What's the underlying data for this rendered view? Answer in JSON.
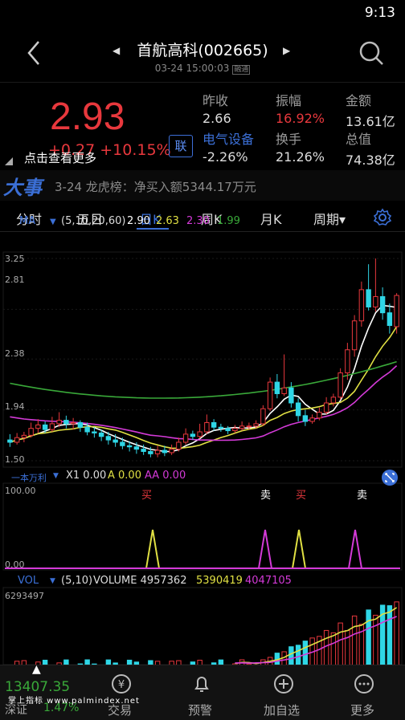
{
  "status": {
    "time": "9:13"
  },
  "header": {
    "title": "首航高科(002665)",
    "subtitle": "03-24 15:00:03",
    "subtitle_badge": "融通"
  },
  "quote": {
    "price": "2.93",
    "change": "+0.27  +10.15%",
    "lian_label": "联",
    "more_label": "点击查看更多",
    "sector": "电气设备",
    "sector_change": "-2.26%",
    "fields": [
      {
        "label": "昨收",
        "value": "2.66"
      },
      {
        "label": "振幅",
        "value": "16.92%"
      },
      {
        "label": "金额",
        "value": "13.61亿"
      },
      {
        "label": "换手",
        "value": "21.26%"
      },
      {
        "label": "总值",
        "value": "74.38亿"
      }
    ],
    "colors": {
      "up": "#e8383d",
      "accent": "#3b6fd6"
    }
  },
  "news": {
    "logo": "大事",
    "text": "3-24 龙虎榜：净买入额5344.17万元"
  },
  "tabs": [
    "分时",
    "五日",
    "日K",
    "周K",
    "月K",
    "周期▾"
  ],
  "active_tab": "日K",
  "ma_bar": {
    "label": "MA",
    "params": "(5,10,20,60)",
    "values": [
      "2.90",
      "2.63",
      "2.30",
      "1.99"
    ],
    "colors": [
      "#ffffff",
      "#e0e043",
      "#d43ad8",
      "#39a839"
    ]
  },
  "indicator": {
    "name": "一本万利",
    "values_text": "X1 0.00",
    "a_text": "A 0.00",
    "aa_text": "AA 0.00",
    "top": "100.00",
    "bottom": "0.00",
    "signals": [
      "买",
      "卖",
      "买",
      "卖"
    ]
  },
  "volume": {
    "label": "VOL",
    "params": "(5,10)",
    "text": "VOLUME 4957362",
    "ma5": "5390419",
    "ma10": "4047105",
    "top": "6293497"
  },
  "price_axis": [
    "3.25",
    "2.81",
    "2.38",
    "1.94",
    "1.50"
  ],
  "index_ticker": {
    "name": "深证",
    "value": "13407.35",
    "change": "1.47%"
  },
  "watermark": "掌上指标 www.palmindex.net",
  "footer": {
    "items": [
      {
        "label": "交易",
        "icon": "yen-icon"
      },
      {
        "label": "预警",
        "icon": "bell-icon"
      },
      {
        "label": "加自选",
        "icon": "plus-circle-icon"
      },
      {
        "label": "更多",
        "icon": "more-icon"
      }
    ]
  },
  "chart_data": {
    "type": "candlestick",
    "ylim": [
      1.5,
      3.25
    ],
    "candles": [
      [
        1.68,
        1.66,
        1.73,
        1.62
      ],
      [
        1.66,
        1.7,
        1.74,
        1.64
      ],
      [
        1.7,
        1.72,
        1.75,
        1.66
      ],
      [
        1.72,
        1.78,
        1.83,
        1.7
      ],
      [
        1.78,
        1.81,
        1.86,
        1.74
      ],
      [
        1.81,
        1.77,
        1.84,
        1.74
      ],
      [
        1.77,
        1.82,
        1.88,
        1.75
      ],
      [
        1.82,
        1.85,
        1.92,
        1.79
      ],
      [
        1.85,
        1.82,
        1.89,
        1.78
      ],
      [
        1.82,
        1.83,
        1.87,
        1.77
      ],
      [
        1.83,
        1.79,
        1.85,
        1.75
      ],
      [
        1.79,
        1.75,
        1.83,
        1.72
      ],
      [
        1.75,
        1.74,
        1.79,
        1.7
      ],
      [
        1.74,
        1.71,
        1.77,
        1.67
      ],
      [
        1.71,
        1.68,
        1.75,
        1.64
      ],
      [
        1.68,
        1.66,
        1.73,
        1.62
      ],
      [
        1.66,
        1.63,
        1.7,
        1.6
      ],
      [
        1.63,
        1.62,
        1.67,
        1.58
      ],
      [
        1.62,
        1.6,
        1.66,
        1.56
      ],
      [
        1.6,
        1.58,
        1.64,
        1.55
      ],
      [
        1.58,
        1.56,
        1.62,
        1.53
      ],
      [
        1.56,
        1.59,
        1.63,
        1.53
      ],
      [
        1.59,
        1.57,
        1.63,
        1.54
      ],
      [
        1.57,
        1.6,
        1.64,
        1.55
      ],
      [
        1.6,
        1.66,
        1.7,
        1.58
      ],
      [
        1.66,
        1.73,
        1.78,
        1.64
      ],
      [
        1.73,
        1.71,
        1.76,
        1.68
      ],
      [
        1.71,
        1.75,
        1.82,
        1.69
      ],
      [
        1.75,
        1.83,
        1.9,
        1.73
      ],
      [
        1.83,
        1.79,
        1.86,
        1.76
      ],
      [
        1.79,
        1.78,
        1.82,
        1.75
      ],
      [
        1.78,
        1.76,
        1.8,
        1.73
      ],
      [
        1.76,
        1.78,
        1.81,
        1.74
      ],
      [
        1.78,
        1.8,
        1.84,
        1.76
      ],
      [
        1.8,
        1.8,
        1.83,
        1.77
      ],
      [
        1.8,
        1.82,
        1.85,
        1.78
      ],
      [
        1.82,
        1.95,
        1.98,
        1.8
      ],
      [
        1.95,
        2.18,
        2.22,
        1.93
      ],
      [
        2.18,
        2.08,
        2.25,
        2.04
      ],
      [
        2.08,
        2.13,
        2.42,
        2.06
      ],
      [
        2.13,
        2.0,
        2.18,
        1.96
      ],
      [
        2.0,
        1.89,
        2.04,
        1.84
      ],
      [
        1.89,
        1.84,
        1.94,
        1.8
      ],
      [
        1.84,
        1.87,
        1.9,
        1.82
      ],
      [
        1.87,
        1.92,
        1.96,
        1.85
      ],
      [
        1.92,
        2.0,
        2.05,
        1.9
      ],
      [
        2.0,
        2.05,
        2.08,
        1.97
      ],
      [
        2.05,
        2.26,
        2.3,
        2.03
      ],
      [
        2.26,
        2.46,
        2.52,
        2.2
      ],
      [
        2.46,
        2.71,
        2.76,
        2.4
      ],
      [
        2.71,
        2.98,
        3.05,
        2.66
      ],
      [
        2.98,
        2.83,
        3.2,
        2.8
      ],
      [
        2.83,
        2.92,
        3.25,
        2.79
      ],
      [
        2.92,
        2.78,
        3.0,
        2.72
      ],
      [
        2.78,
        2.67,
        2.86,
        2.6
      ],
      [
        2.66,
        2.93,
        2.95,
        2.6
      ]
    ]
  }
}
